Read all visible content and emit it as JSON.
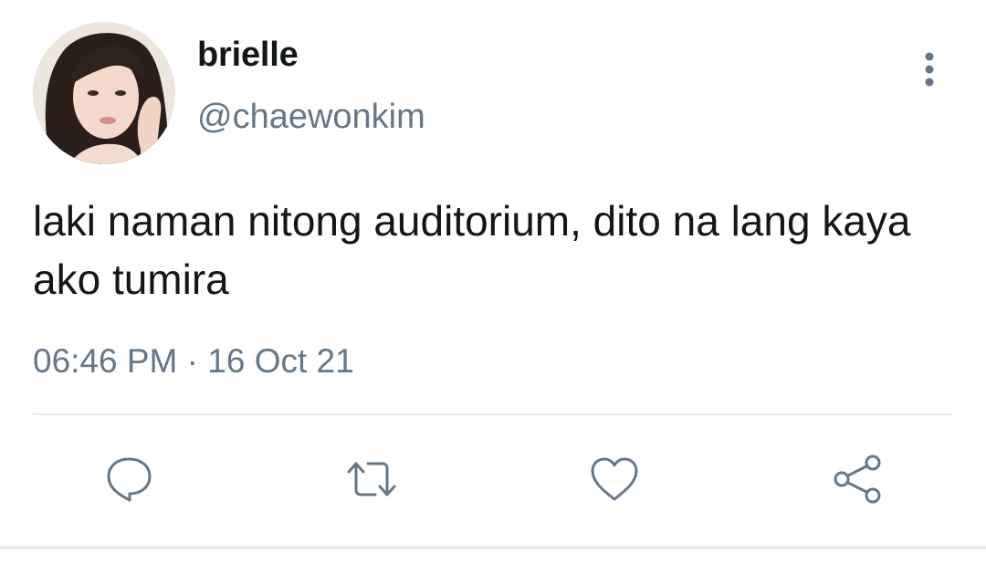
{
  "tweet": {
    "author": {
      "display_name": "brielle",
      "handle": "@chaewonkim",
      "avatar": "profile-photo"
    },
    "text": "laki naman nitong auditorium, dito na lang kaya ako tumira",
    "time": "06:46 PM",
    "separator": "·",
    "date": "16 Oct 21"
  },
  "actions": {
    "reply": "reply-icon",
    "retweet": "retweet-icon",
    "like": "heart-icon",
    "share": "share-icon"
  },
  "menu": {
    "icon": "more-vertical-icon"
  },
  "colors": {
    "text_primary": "#14171a",
    "text_secondary": "#657786",
    "divider": "#e6ecf0",
    "background": "#ffffff"
  }
}
